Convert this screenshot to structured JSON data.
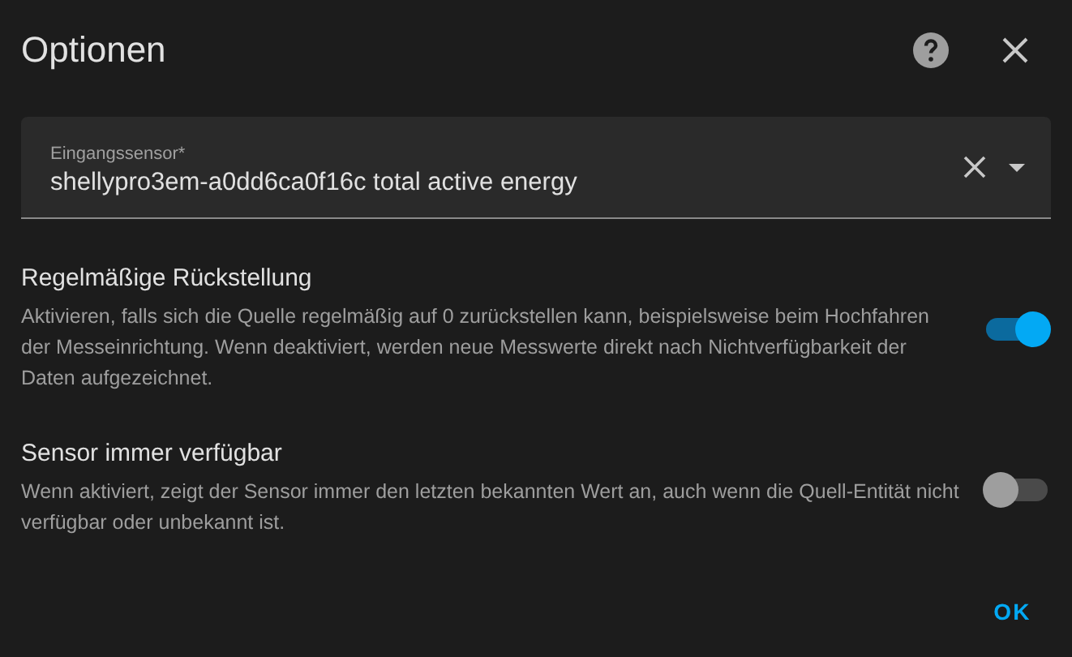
{
  "dialog": {
    "title": "Optionen"
  },
  "field": {
    "label": "Eingangssensor*",
    "value": "shellypro3em-a0dd6ca0f16c total active energy"
  },
  "settings": [
    {
      "title": "Regelmäßige Rückstellung",
      "description": "Aktivieren, falls sich die Quelle regelmäßig auf 0 zurückstellen kann, beispielsweise beim Hochfahren der Messeinrichtung. Wenn deaktiviert, werden neue Messwerte direkt nach Nichtverfügbarkeit der Daten aufgezeichnet.",
      "on": true
    },
    {
      "title": "Sensor immer verfügbar",
      "description": "Wenn aktiviert, zeigt der Sensor immer den letzten bekannten Wert an, auch wenn die Quell-Entität nicht verfügbar oder unbekannt ist.",
      "on": false
    }
  ],
  "buttons": [
    "OK"
  ]
}
